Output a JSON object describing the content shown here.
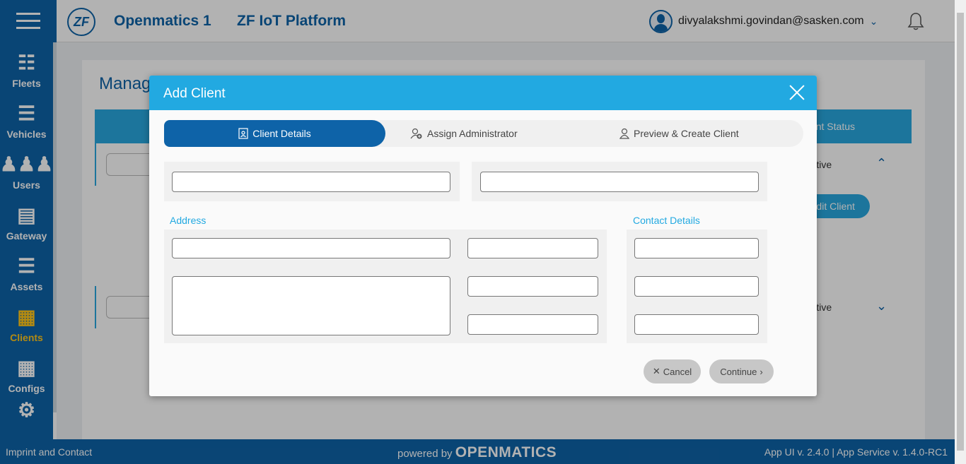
{
  "header": {
    "logo_text": "ZF",
    "app_name": "Openmatics 1",
    "platform_name": "ZF IoT Platform",
    "user_email": "divyalakshmi.govindan@sasken.com",
    "user_menu_icon": "chevron-down-icon",
    "notifications_icon": "bell-icon"
  },
  "sidebar": {
    "items": [
      {
        "label": "Fleets",
        "icon": "fleet-hierarchy-icon"
      },
      {
        "label": "Vehicles",
        "icon": "list-icon"
      },
      {
        "label": "Users",
        "icon": "users-icon"
      },
      {
        "label": "Gateway",
        "icon": "gateway-icon"
      },
      {
        "label": "Assets",
        "icon": "list-icon"
      },
      {
        "label": "Clients",
        "icon": "building-icon",
        "active": true
      },
      {
        "label": "Configs",
        "icon": "building-icon"
      }
    ]
  },
  "page": {
    "title": "Manage Client",
    "status_column": "Client Status",
    "row1_status": "Active",
    "row2_status": "Active",
    "edit_client": "Edit Client"
  },
  "modal": {
    "title": "Add Client",
    "steps": [
      {
        "label": "Client Details",
        "icon": "id-card-icon",
        "active": true
      },
      {
        "label": "Assign Administrator",
        "icon": "user-add-icon",
        "active": false
      },
      {
        "label": "Preview & Create Client",
        "icon": "user-icon",
        "active": false
      }
    ],
    "address_label": "Address",
    "contact_label": "Contact Details",
    "cancel_label": "Cancel",
    "continue_label": "Continue"
  },
  "footer": {
    "imprint": "Imprint and Contact",
    "powered_by": "powered by",
    "brand": "OPENMATICS",
    "version": "App UI v. 2.4.0 | App Service v. 1.4.0-RC1"
  },
  "colors": {
    "brand_blue": "#0e63a8",
    "accent_cyan": "#22a9e1",
    "active_yellow": "#ffc61a"
  }
}
